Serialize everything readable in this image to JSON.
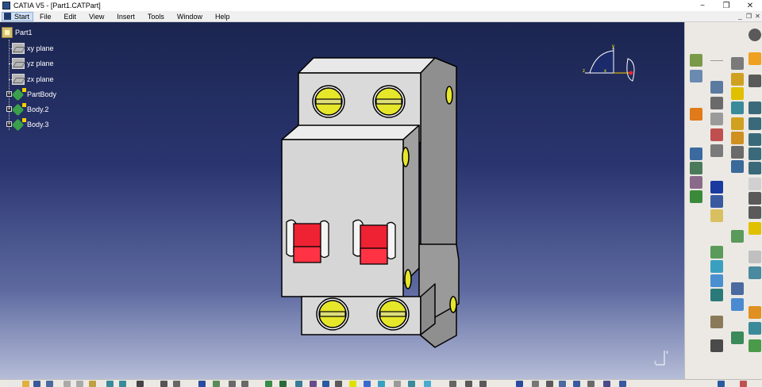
{
  "window": {
    "title": "CATIA V5 - [Part1.CATPart]",
    "controls": {
      "minimize": "−",
      "maximize": "❐",
      "close": "✕"
    }
  },
  "menubar": {
    "start": "Start",
    "items": [
      "File",
      "Edit",
      "View",
      "Insert",
      "Tools",
      "Window",
      "Help"
    ],
    "mdi_controls": [
      "_",
      "❐",
      "✕"
    ]
  },
  "tree": {
    "root": "Part1",
    "children": [
      "xy plane",
      "yz plane",
      "zx plane",
      "PartBody",
      "Body.2",
      "Body.3"
    ]
  },
  "compass": {
    "x_label": "x",
    "y_label": "y",
    "z_label": "z"
  },
  "mini_axis": {
    "x_label": "x",
    "z_label": "z"
  },
  "colors": {
    "breaker_body": "#dcdcdc",
    "breaker_outline": "#000000",
    "screw": "#e6e62a",
    "toggle": "#ee2233",
    "accent": "#2c4f8a"
  }
}
